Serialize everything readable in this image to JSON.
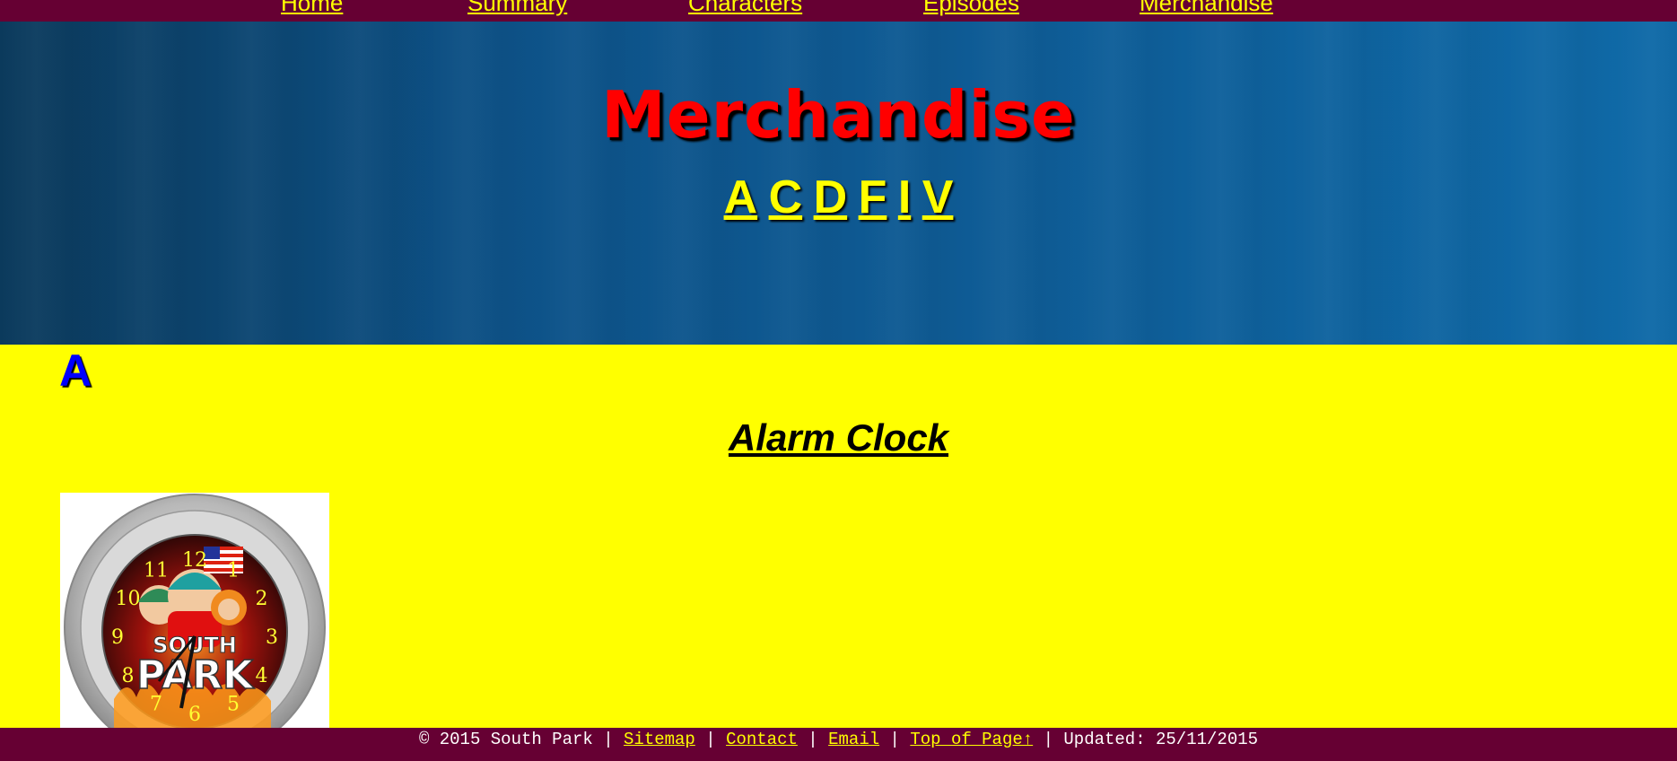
{
  "nav": {
    "items": [
      {
        "label": "Home"
      },
      {
        "label": "Summary"
      },
      {
        "label": "Characters"
      },
      {
        "label": "Episodes"
      },
      {
        "label": "Merchandise"
      }
    ]
  },
  "header": {
    "title": "Merchandise",
    "letters": [
      "A",
      "C",
      "D",
      "F",
      "I",
      "V"
    ]
  },
  "section": {
    "letter": "A",
    "item_title": "Alarm Clock",
    "image": {
      "clock_numbers": [
        "12",
        "1",
        "2",
        "3",
        "4",
        "5",
        "6",
        "7",
        "8",
        "9",
        "10",
        "11"
      ],
      "logo_line1": "SOUTH",
      "logo_line2": "PARK"
    }
  },
  "footer": {
    "copyright": "© 2015 South Park",
    "sep": "|",
    "sitemap": "Sitemap",
    "contact": "Contact",
    "email": "Email",
    "top": "Top of Page↑",
    "updated": "Updated: 25/11/2015"
  },
  "colors": {
    "nav_bg": "#660033",
    "link": "#ffff00",
    "title_red": "#ff0000",
    "content_bg": "#ffff00",
    "section_letter": "#0000ff"
  }
}
